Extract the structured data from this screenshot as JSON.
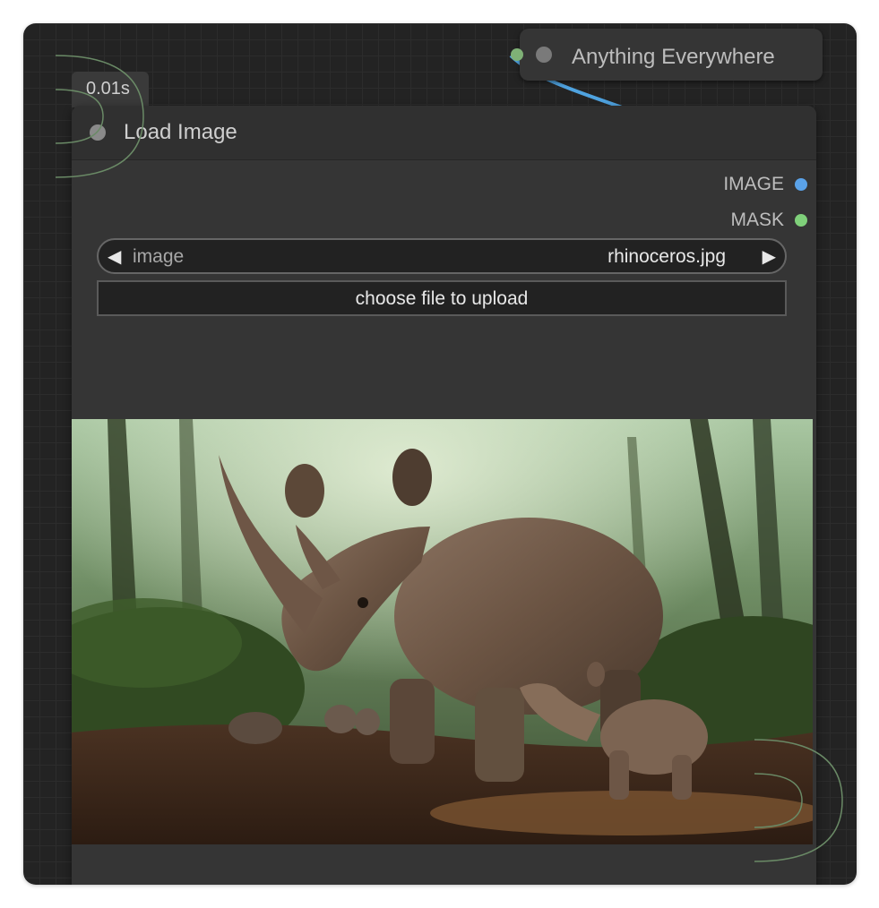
{
  "anything_everywhere_node": {
    "title": "Anything Everywhere"
  },
  "timer": {
    "label": "0.01s"
  },
  "load_image_node": {
    "title": "Load Image",
    "outputs": [
      {
        "label": "IMAGE",
        "color": "#5aa2e8"
      },
      {
        "label": "MASK",
        "color": "#7fd07a"
      }
    ],
    "image_widget": {
      "label": "image",
      "value": "rhinoceros.jpg"
    },
    "upload_button": {
      "label": "choose file to upload"
    }
  },
  "colors": {
    "canvas_bg": "#232323",
    "node_bg": "#353535",
    "wire": "#4fa3e0",
    "slot_image": "#5aa2e8",
    "slot_mask": "#7fd07a"
  }
}
